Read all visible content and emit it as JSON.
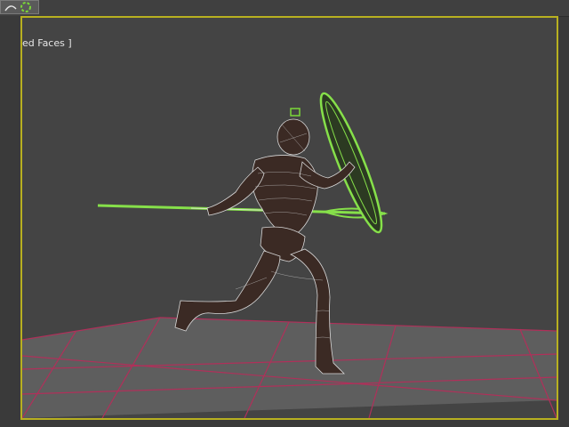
{
  "viewport": {
    "label": "ed Faces ]",
    "border_color": "#b8b020",
    "background": "#444444"
  },
  "toolbar": {
    "button_icon": "curve-editor-icon"
  },
  "scene": {
    "object": "character-wireframe",
    "prop_color": "#86e04a",
    "grid_color": "#b0305a",
    "floor_color": "#5e5e5e"
  }
}
